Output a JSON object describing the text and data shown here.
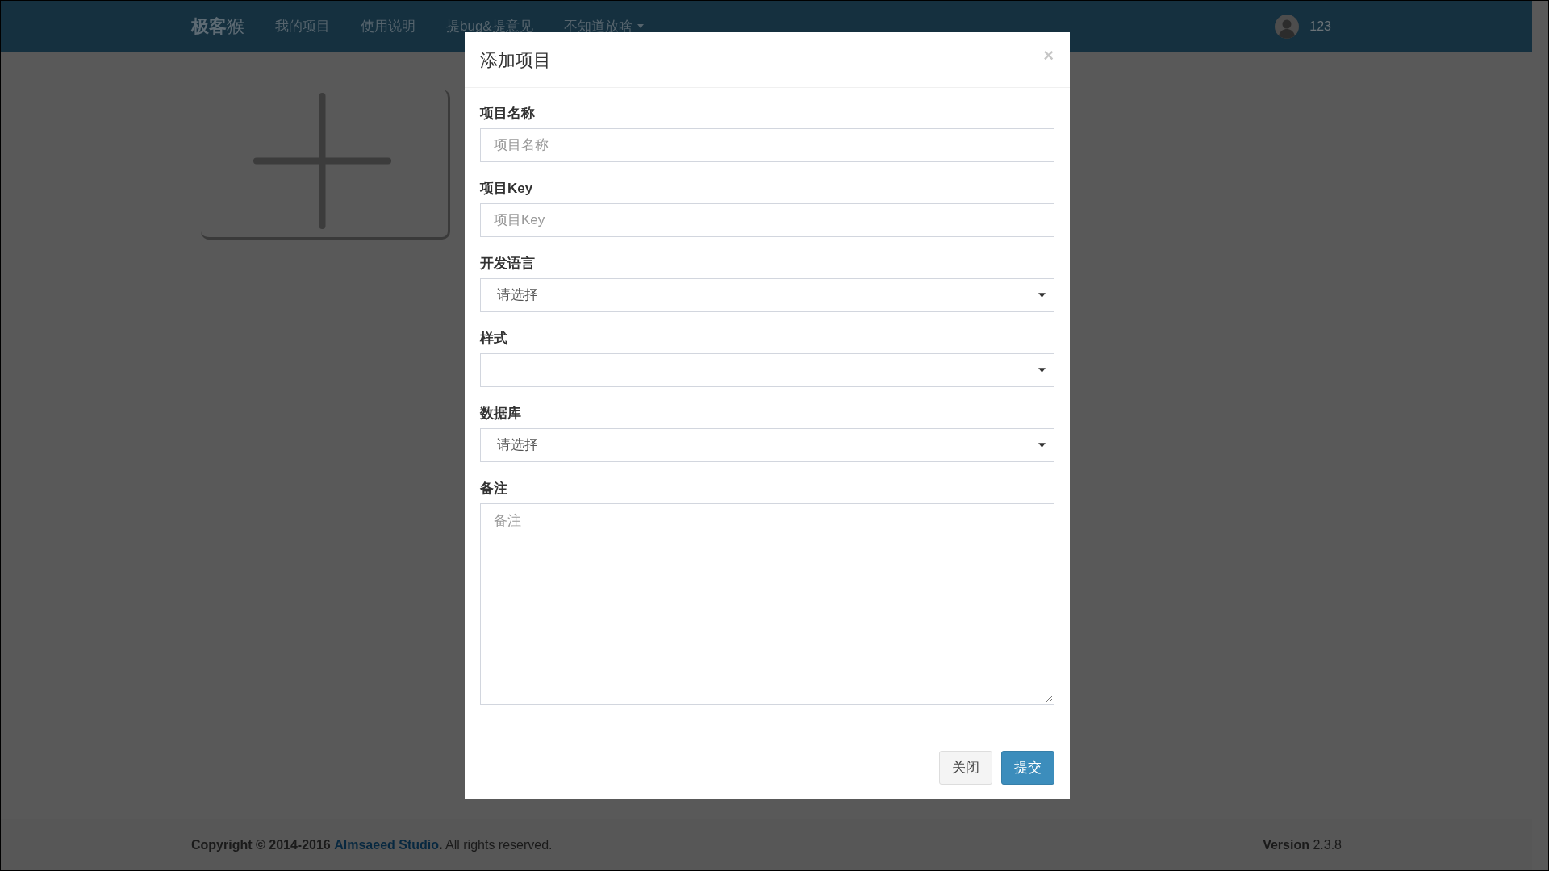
{
  "navbar": {
    "logo": "**极客**猴",
    "items": [
      {
        "label": "我的项目",
        "kind": "link"
      },
      {
        "label": "使用说明",
        "kind": "link"
      },
      {
        "label": "提bug&提意见",
        "kind": "link"
      },
      {
        "label": "不知道放啥",
        "kind": "dropdown"
      }
    ],
    "user": {
      "name": "123"
    }
  },
  "modal": {
    "title": "添加项目",
    "close": "×",
    "fields": [
      {
        "label": "项目名称",
        "kind": "text",
        "placeholder": "项目名称"
      },
      {
        "label": "项目Key",
        "kind": "text",
        "placeholder": "项目Key"
      },
      {
        "label": "开发语言",
        "kind": "select",
        "value": "请选择"
      },
      {
        "label": "样式",
        "kind": "select"
      },
      {
        "label": "数据库",
        "kind": "select",
        "value": "请选择"
      },
      {
        "label": "备注",
        "kind": "textarea",
        "placeholder": "备注"
      }
    ],
    "buttons": [
      {
        "label": "关闭",
        "kind": "default"
      },
      {
        "label": "提交",
        "kind": "primary"
      }
    ]
  },
  "footer": {
    "copyright": {
      "before": "Copyright © 2014-2016",
      "link": "Almsaeed Studio",
      "after": "**.** All rights reserved."
    },
    "version": "**Version** 2.3.8"
  }
}
